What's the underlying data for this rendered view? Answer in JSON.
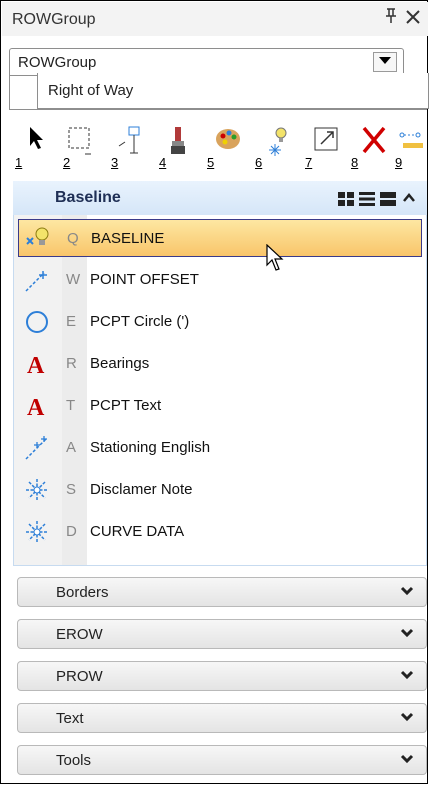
{
  "window": {
    "title": "ROWGroup",
    "pin_glyph": "ɥ",
    "close_glyph": "✕"
  },
  "group_select": {
    "value": "ROWGroup"
  },
  "subgroup": {
    "value": "Right of Way"
  },
  "toolbar": {
    "numbers": [
      "1",
      "2",
      "3",
      "4",
      "5",
      "6",
      "7",
      "8",
      "9"
    ]
  },
  "section": {
    "title": "Baseline",
    "items": [
      {
        "key": "Q",
        "label": "BASELINE",
        "icon": "bulb-icon",
        "selected": true
      },
      {
        "key": "W",
        "label": "POINT OFFSET",
        "icon": "point-offset-icon"
      },
      {
        "key": "E",
        "label": "PCPT Circle (')",
        "icon": "circle-icon"
      },
      {
        "key": "R",
        "label": "Bearings",
        "icon": "text-a-icon"
      },
      {
        "key": "T",
        "label": "PCPT Text",
        "icon": "text-a-icon"
      },
      {
        "key": "A",
        "label": "Stationing English",
        "icon": "stationing-icon"
      },
      {
        "key": "S",
        "label": "Disclamer Note",
        "icon": "sparkle-icon"
      },
      {
        "key": "D",
        "label": "CURVE DATA",
        "icon": "sparkle-icon"
      }
    ]
  },
  "accordions": [
    "Borders",
    "EROW",
    "PROW",
    "Text",
    "Tools"
  ],
  "colors": {
    "header_text": "#1f2f55",
    "selected_bg": "#f9c56a",
    "selected_border": "#3a3a8a",
    "icon_red": "#c00000",
    "icon_blue": "#2d7fd8"
  }
}
